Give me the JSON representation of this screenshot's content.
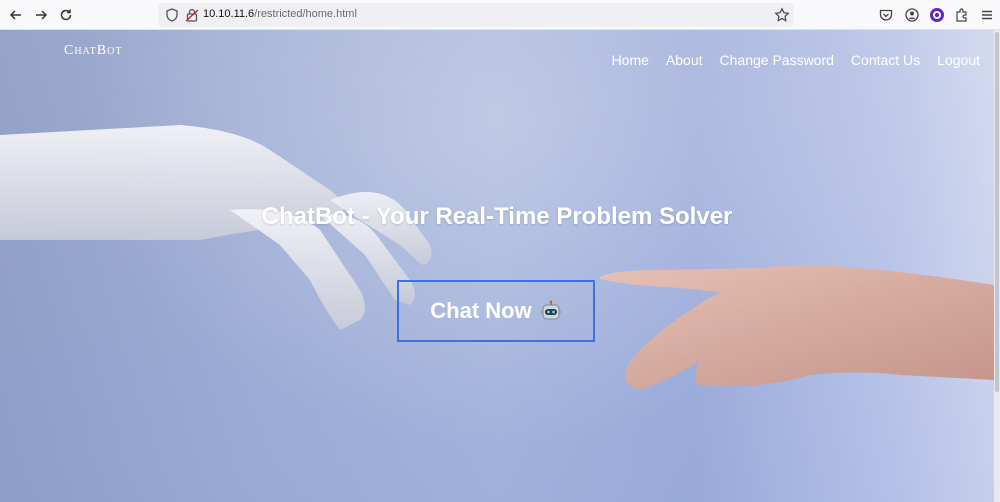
{
  "browser": {
    "url_host": "10.10.11.6",
    "url_path": "/restricted/home.html"
  },
  "site": {
    "brand": "ChatBot",
    "nav": [
      {
        "label": "Home"
      },
      {
        "label": "About"
      },
      {
        "label": "Change Password"
      },
      {
        "label": "Contact Us"
      },
      {
        "label": "Logout"
      }
    ]
  },
  "hero": {
    "title": "ChatBot - Your Real-Time Problem Solver",
    "cta_label": "Chat Now",
    "cta_icon": "robot-icon"
  },
  "colors": {
    "cta_border": "#3a72e0",
    "text": "#ffffff"
  }
}
